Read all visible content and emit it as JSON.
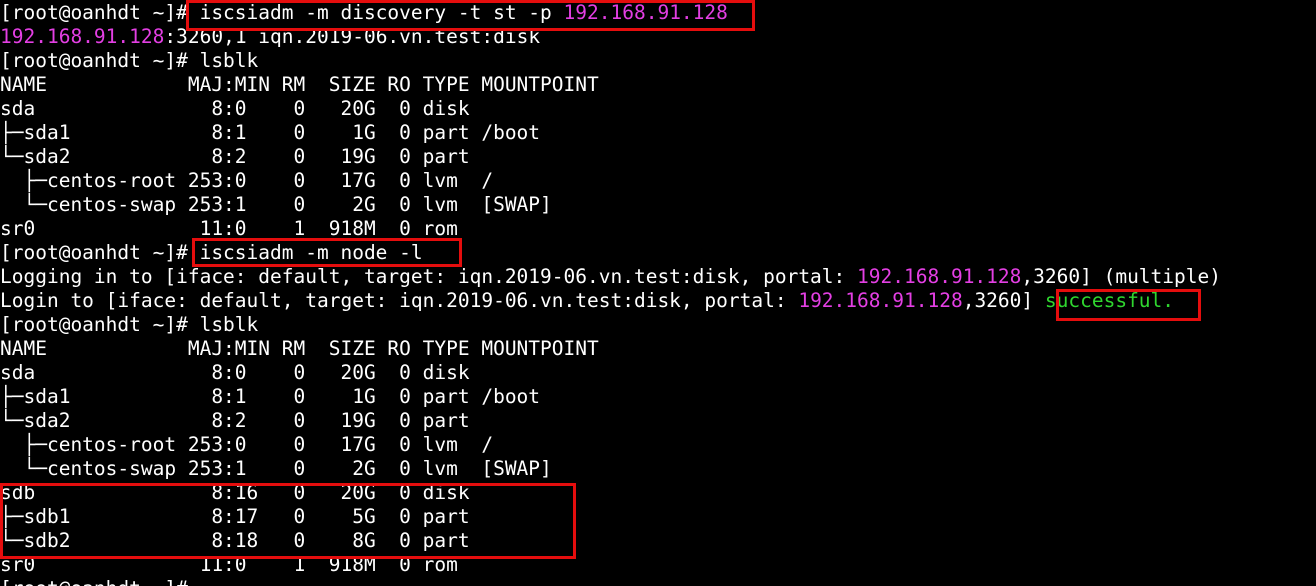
{
  "colors": {
    "background": "#000000",
    "foreground": "#ffffff",
    "ip_highlight": "#e43fe4",
    "success_highlight": "#2fd62f",
    "annotation_box": "#e50d0d"
  },
  "terminal": {
    "lines": [
      {
        "segments": [
          {
            "text": "[root@oanhdt ~]# iscsiadm -m discovery -t st -p "
          },
          {
            "text": "192.168.91.128",
            "color": "magenta"
          }
        ]
      },
      {
        "segments": [
          {
            "text": "192.168.91.128",
            "color": "magenta"
          },
          {
            "text": ":3260,1 iqn.2019-06.vn.test:disk"
          }
        ]
      },
      {
        "segments": [
          {
            "text": "[root@oanhdt ~]# lsblk"
          }
        ]
      },
      {
        "segments": [
          {
            "text": "NAME            MAJ:MIN RM  SIZE RO TYPE MOUNTPOINT"
          }
        ]
      },
      {
        "segments": [
          {
            "text": "sda               8:0    0   20G  0 disk"
          }
        ]
      },
      {
        "segments": [
          {
            "text": "├─sda1            8:1    0    1G  0 part /boot"
          }
        ]
      },
      {
        "segments": [
          {
            "text": "└─sda2            8:2    0   19G  0 part"
          }
        ]
      },
      {
        "segments": [
          {
            "text": "  ├─centos-root 253:0    0   17G  0 lvm  /"
          }
        ]
      },
      {
        "segments": [
          {
            "text": "  └─centos-swap 253:1    0    2G  0 lvm  [SWAP]"
          }
        ]
      },
      {
        "segments": [
          {
            "text": "sr0              11:0    1  918M  0 rom"
          }
        ]
      },
      {
        "segments": [
          {
            "text": "[root@oanhdt ~]# iscsiadm -m node -l"
          }
        ]
      },
      {
        "segments": [
          {
            "text": "Logging in to [iface: default, target: iqn.2019-06.vn.test:disk, portal: "
          },
          {
            "text": "192.168.91.128",
            "color": "magenta"
          },
          {
            "text": ",3260] (multiple)"
          }
        ]
      },
      {
        "segments": [
          {
            "text": "Login to [iface: default, target: iqn.2019-06.vn.test:disk, portal: "
          },
          {
            "text": "192.168.91.128",
            "color": "magenta"
          },
          {
            "text": ",3260] "
          },
          {
            "text": "successful.",
            "color": "green"
          }
        ]
      },
      {
        "segments": [
          {
            "text": "[root@oanhdt ~]# lsblk"
          }
        ]
      },
      {
        "segments": [
          {
            "text": "NAME            MAJ:MIN RM  SIZE RO TYPE MOUNTPOINT"
          }
        ]
      },
      {
        "segments": [
          {
            "text": "sda               8:0    0   20G  0 disk"
          }
        ]
      },
      {
        "segments": [
          {
            "text": "├─sda1            8:1    0    1G  0 part /boot"
          }
        ]
      },
      {
        "segments": [
          {
            "text": "└─sda2            8:2    0   19G  0 part"
          }
        ]
      },
      {
        "segments": [
          {
            "text": "  ├─centos-root 253:0    0   17G  0 lvm  /"
          }
        ]
      },
      {
        "segments": [
          {
            "text": "  └─centos-swap 253:1    0    2G  0 lvm  [SWAP]"
          }
        ]
      },
      {
        "segments": [
          {
            "text": "sdb               8:16   0   20G  0 disk"
          }
        ]
      },
      {
        "segments": [
          {
            "text": "├─sdb1            8:17   0    5G  0 part"
          }
        ]
      },
      {
        "segments": [
          {
            "text": "└─sdb2            8:18   0    8G  0 part"
          }
        ]
      },
      {
        "segments": [
          {
            "text": "sr0              11:0    1  918M  0 rom"
          }
        ]
      },
      {
        "segments": [
          {
            "text": "[root@oanhdt ~]# "
          }
        ]
      }
    ]
  }
}
